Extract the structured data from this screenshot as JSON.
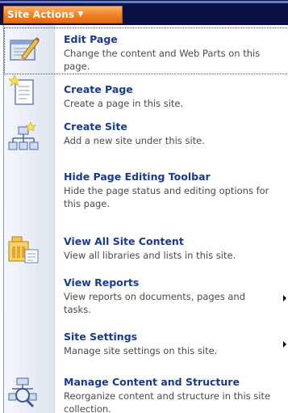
{
  "site_actions": {
    "label": "Site Actions",
    "caret": "▼"
  },
  "menu": {
    "items": [
      {
        "title": "Edit Page",
        "description": "Change the content and Web Parts on this page.",
        "icon": "edit-page-icon",
        "selected": true
      },
      {
        "title": "Create Page",
        "description": "Create a page in this site.",
        "icon": "create-page-icon"
      },
      {
        "title": "Create Site",
        "description": "Add a new site under this site.",
        "icon": "create-site-icon"
      },
      {
        "title": "Hide Page Editing Toolbar",
        "description": "Hide the page status and editing options for this page.",
        "icon": null
      },
      {
        "title": "View All Site Content",
        "description": "View all libraries and lists in this site.",
        "icon": "view-all-content-icon"
      },
      {
        "title": "View Reports",
        "description": "View reports on documents, pages and tasks.",
        "icon": null,
        "has_submenu": true
      },
      {
        "title": "Site Settings",
        "description": "Manage site settings on this site.",
        "icon": null,
        "has_submenu": true
      },
      {
        "title": "Manage Content and Structure",
        "description": "Reorganize content and structure in this site collection.",
        "icon": "manage-content-icon"
      }
    ]
  },
  "colors": {
    "title": "#1a3a8e",
    "description": "#4a4a4a",
    "topbar": "#0c0f44",
    "button": "#f07f22"
  }
}
